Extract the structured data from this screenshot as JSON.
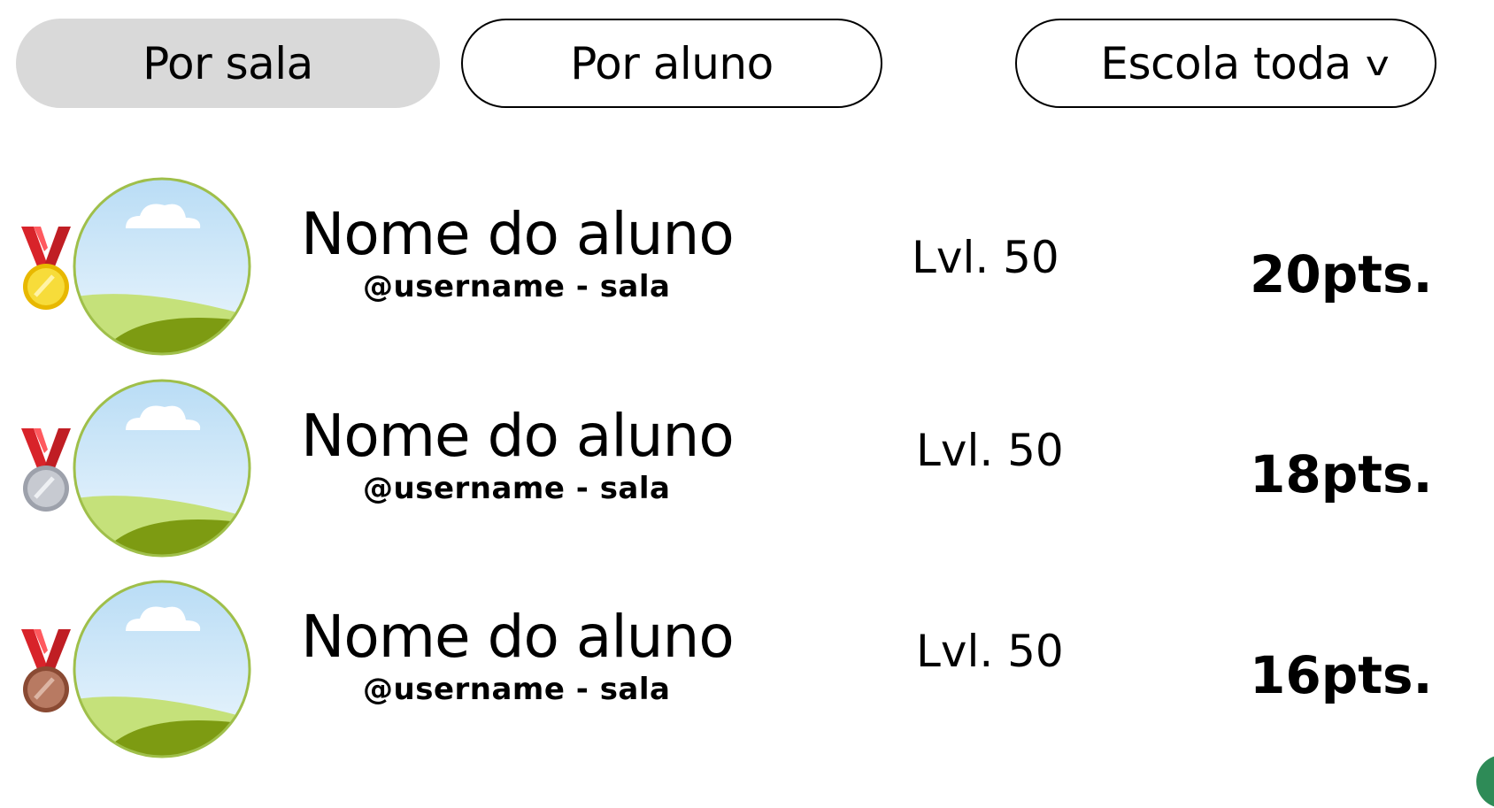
{
  "filters": {
    "by_class_label": "Por sala",
    "by_student_label": "Por aluno",
    "scope_label": "Escola toda",
    "scope_chevron": "v"
  },
  "colors": {
    "active_pill": "#d9d9d9",
    "gold": "#f2d21b",
    "silver": "#b9bcc4",
    "bronze": "#a8654a",
    "ribbon": "#d8232a",
    "avatar_ring": "#9fbf4a",
    "sky": "#cfe8f7",
    "grass_light": "#c5e17a",
    "grass_dark": "#7d9b12"
  },
  "ranking": [
    {
      "medal": "gold-medal-icon",
      "name": "Nome do aluno",
      "handle": "@username - sala",
      "level": "Lvl. 50",
      "points": "20pts."
    },
    {
      "medal": "silver-medal-icon",
      "name": "Nome do aluno",
      "handle": "@username - sala",
      "level": "Lvl. 50",
      "points": "18pts."
    },
    {
      "medal": "bronze-medal-icon",
      "name": "Nome do aluno",
      "handle": "@username - sala",
      "level": "Lvl. 50",
      "points": "16pts."
    }
  ]
}
